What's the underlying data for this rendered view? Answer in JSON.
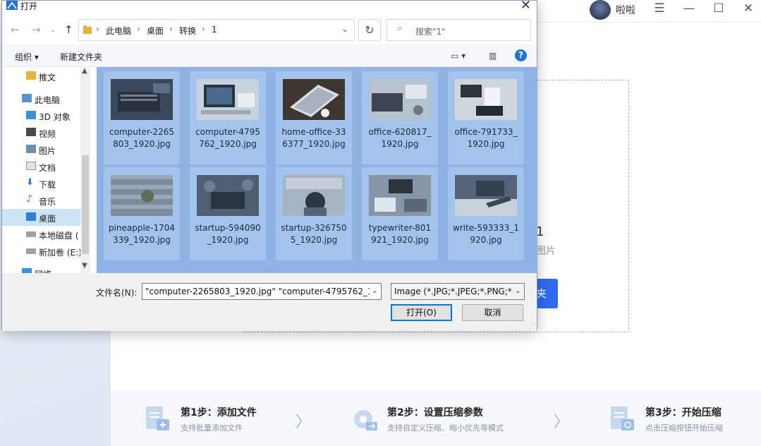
{
  "app": {
    "username": "啦啦",
    "drop_title": "1",
    "drop_hint": "图片",
    "drop_button": "夹",
    "steps": [
      {
        "title": "第1步：添加文件",
        "sub": "支持批量添加文件"
      },
      {
        "title": "第2步：设置压缩参数",
        "sub": "支持自定义压缩、缩小优先等模式"
      },
      {
        "title": "第3步：开始压缩",
        "sub": "点击压缩按钮开始压缩"
      }
    ]
  },
  "dialog": {
    "title": "打开",
    "breadcrumb": [
      "此电脑",
      "桌面",
      "转换",
      "1"
    ],
    "search_placeholder": "搜索\"1\"",
    "organize": "组织 ▾",
    "new_folder": "新建文件夹",
    "nav_items": [
      {
        "label": "推文",
        "icon": "folder-icon"
      },
      {
        "label": "此电脑",
        "icon": "computer-icon"
      },
      {
        "label": "3D 对象",
        "icon": "cube-icon"
      },
      {
        "label": "视频",
        "icon": "video-icon"
      },
      {
        "label": "图片",
        "icon": "picture-icon"
      },
      {
        "label": "文档",
        "icon": "document-icon"
      },
      {
        "label": "下载",
        "icon": "download-icon"
      },
      {
        "label": "音乐",
        "icon": "music-icon"
      },
      {
        "label": "桌面",
        "icon": "desktop-icon"
      },
      {
        "label": "本地磁盘 (",
        "icon": "drive-icon"
      },
      {
        "label": "新加卷 (E:)",
        "icon": "drive-icon"
      },
      {
        "label": "网络",
        "icon": "network-icon"
      }
    ],
    "files": [
      {
        "line1": "computer-2265",
        "line2": "803_1920.jpg"
      },
      {
        "line1": "computer-4795",
        "line2": "762_1920.jpg"
      },
      {
        "line1": "home-office-33",
        "line2": "6377_1920.jpg"
      },
      {
        "line1": "office-620817_",
        "line2": "1920.jpg"
      },
      {
        "line1": "office-791733_",
        "line2": "1920.jpg"
      },
      {
        "line1": "pineapple-1704",
        "line2": "339_1920.jpg"
      },
      {
        "line1": "startup-594090",
        "line2": "_1920.jpg"
      },
      {
        "line1": "startup-326750",
        "line2": "5_1920.jpg"
      },
      {
        "line1": "typewriter-801",
        "line2": "921_1920.jpg"
      },
      {
        "line1": "write-593333_1",
        "line2": "920.jpg"
      }
    ],
    "filename_label": "文件名(N):",
    "filename_value": "\"computer-2265803_1920.jpg\" \"computer-4795762_1",
    "filetype_value": "Image (*.JPG;*.JPEG;*.PNG;*.E",
    "open_button": "打开(O)",
    "cancel_button": "取消"
  }
}
